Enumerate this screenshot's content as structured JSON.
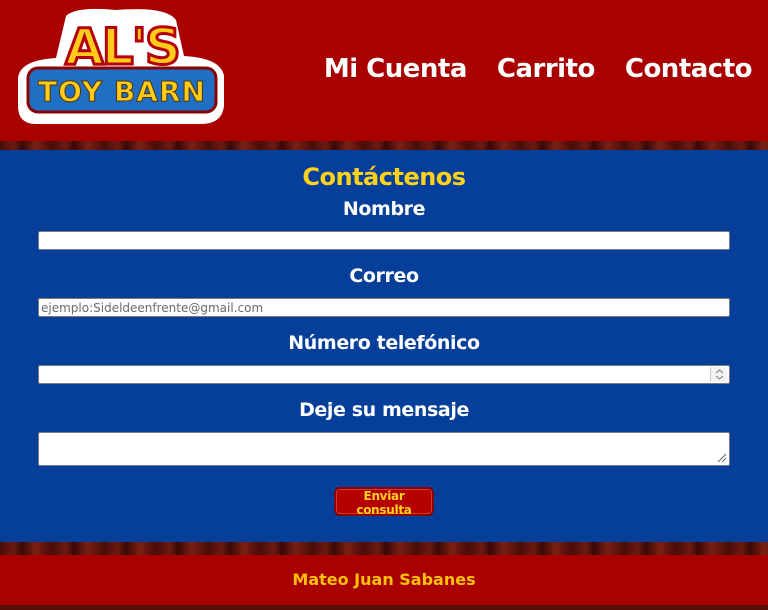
{
  "brand": {
    "logo_line1": "AL'S",
    "logo_line2": "TOY BARN"
  },
  "nav": {
    "items": [
      "Mi Cuenta",
      "Carrito",
      "Contacto"
    ]
  },
  "form": {
    "title": "Contáctenos",
    "name_label": "Nombre",
    "name_value": "",
    "email_label": "Correo",
    "email_placeholder": "ejemplo:Sideldeenfrente@gmail.com",
    "phone_label": "Número telefónico",
    "phone_value": "",
    "message_label": "Deje su mensaje",
    "message_value": "",
    "submit_label": "Enviar consulta"
  },
  "footer": {
    "author": "Mateo Juan Sabanes"
  },
  "colors": {
    "header_red": "#a90000",
    "form_blue": "#063f9a",
    "title_yellow": "#ffd21a",
    "footer_text": "#ffc107"
  }
}
